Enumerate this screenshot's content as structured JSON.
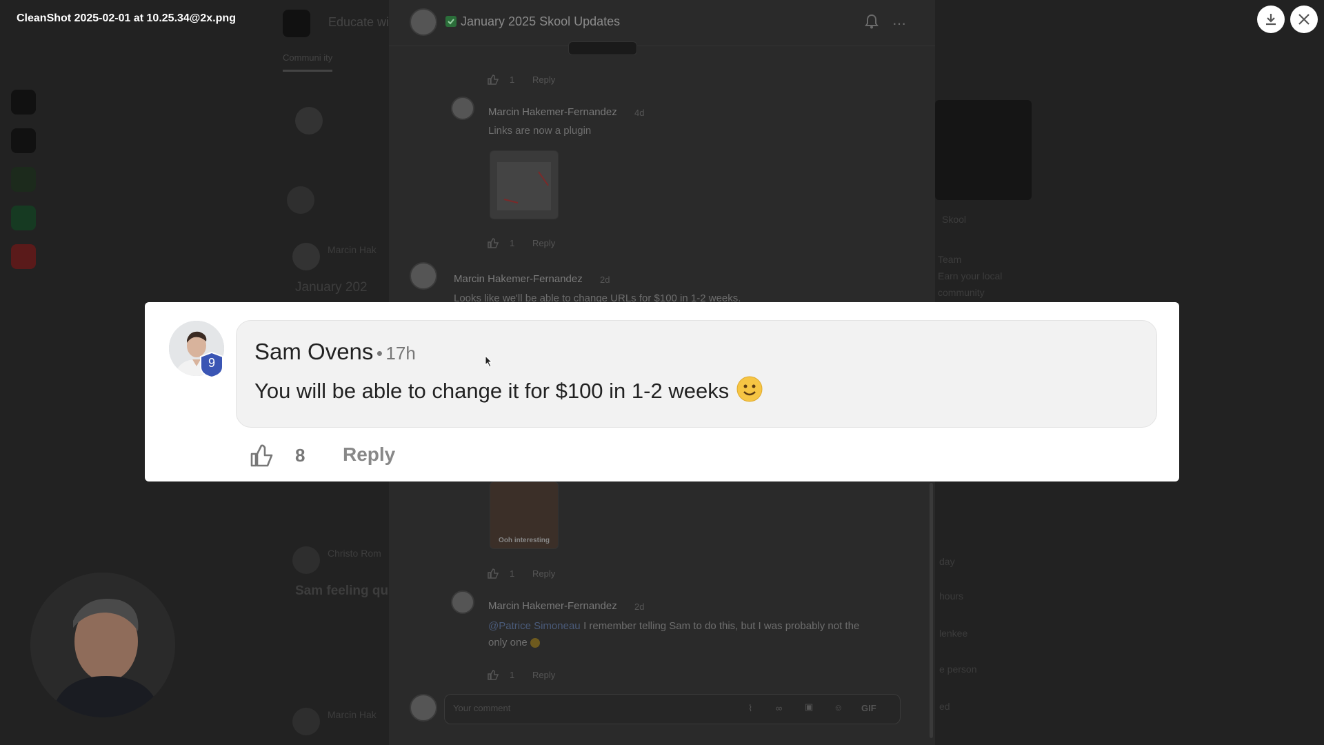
{
  "viewer": {
    "filename": "CleanShot 2025-02-01 at 10.25.34@2x.png",
    "download_icon": "download-icon",
    "close_icon": "close-icon"
  },
  "background_app": {
    "header_title": "Educate wi",
    "tab_label": "Communi ity",
    "left_post_author": "Marcin Hak",
    "left_post_title": "January 202",
    "left_post2_author": "Christo Rom",
    "left_post2_title": "Sam feeling qu",
    "left_post3_author": "Marcin Hak",
    "right_group_name": "Skool",
    "right_lines": [
      "Team",
      "Earn your local",
      "community"
    ],
    "right_list": [
      "day",
      "hours",
      "lenkee",
      "e person",
      "ed"
    ]
  },
  "post": {
    "title": "January 2025 Skool Updates",
    "title_emoji_color": "#2fa84f",
    "comments": [
      {
        "likes": "1",
        "reply": "Reply"
      },
      {
        "author": "Marcin Hakemer-Fernandez",
        "time": "4d",
        "text": "Links are now a plugin",
        "likes": "1",
        "reply": "Reply"
      },
      {
        "author": "Marcin Hakemer-Fernandez",
        "time": "2d",
        "text": "Looks like we'll be able to change URLs for $100 in 1-2 weeks."
      },
      {
        "likes": "1",
        "reply": "Reply",
        "thumb_caption": "Ooh interesting"
      },
      {
        "author": "Marcin Hakemer-Fernandez",
        "time": "2d",
        "mention": "@Patrice Simoneau",
        "text": "I remember telling Sam to do this, but I was probably not the only one",
        "likes": "1",
        "reply": "Reply"
      }
    ],
    "comment_placeholder": "Your comment",
    "composer_gif": "GIF"
  },
  "highlight": {
    "author": "Sam Ovens",
    "separator": "•",
    "time": "17h",
    "text": "You will be able to change it for $100 in 1-2 weeks",
    "emoji": "🙂",
    "level": "9",
    "likes": "8",
    "reply": "Reply",
    "badge_color": "#3a55b4"
  }
}
